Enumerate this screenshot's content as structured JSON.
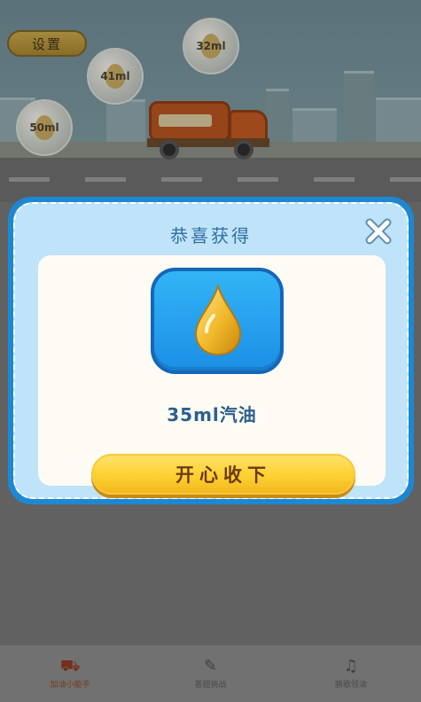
{
  "scene": {
    "settings_label": "设置",
    "bubbles": [
      {
        "label": "32ml"
      },
      {
        "label": "41ml"
      },
      {
        "label": "50ml"
      }
    ],
    "truck_badge_text": ""
  },
  "bottom_nav": {
    "items": [
      {
        "label": "加油小能手",
        "icon": "truck-icon",
        "active": true
      },
      {
        "label": "答题挑战",
        "icon": "quiz-icon",
        "active": false
      },
      {
        "label": "猜歌领油",
        "icon": "music-icon",
        "active": false
      }
    ]
  },
  "reward_modal": {
    "title": "恭喜获得",
    "reward_text": "35ml汽油",
    "collect_label": "开心收下",
    "icon": "oil-drop-icon"
  },
  "colors": {
    "modal_border": "#1d88d2",
    "modal_bg": "#bfe3f8",
    "tile_blue": "#1b8fe6",
    "button_yellow": "#fdd02f",
    "drop_gold": "#f0b72a"
  }
}
